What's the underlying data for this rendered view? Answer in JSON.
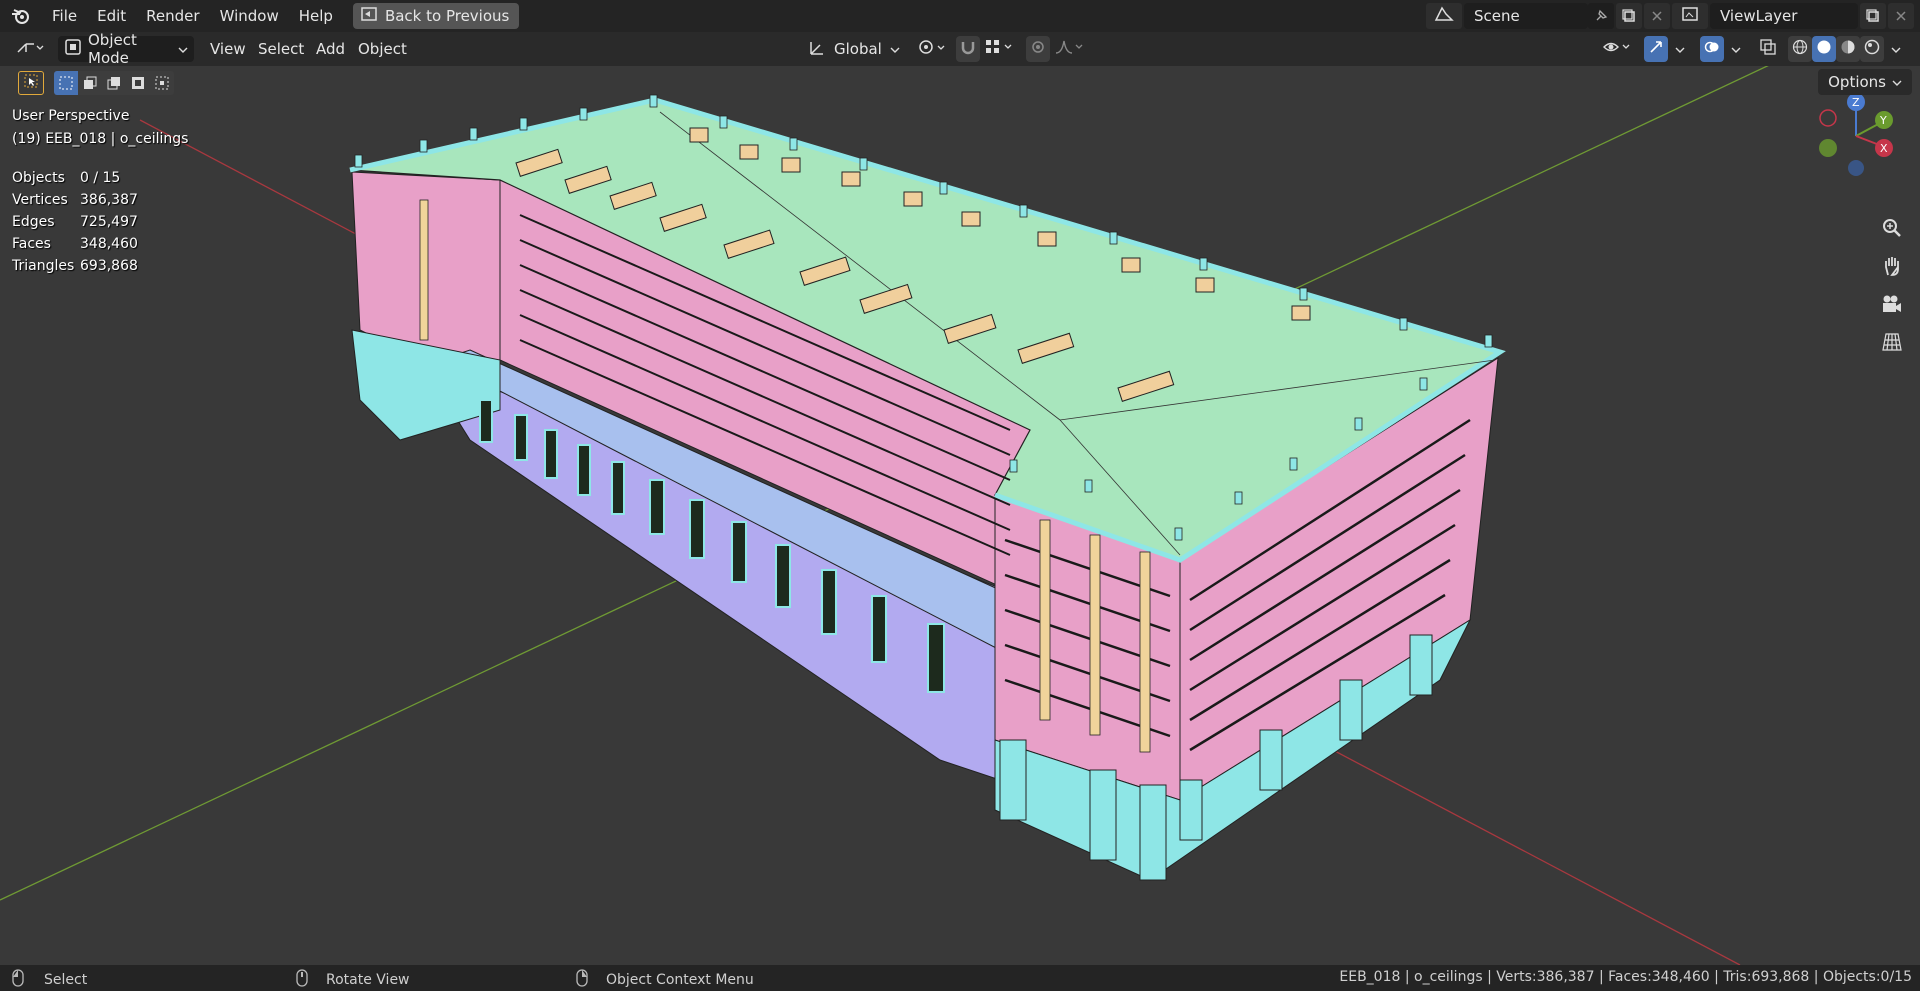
{
  "menu": {
    "items": [
      "File",
      "Edit",
      "Render",
      "Window",
      "Help"
    ],
    "back_button": "Back to Previous"
  },
  "scene": {
    "name": "Scene"
  },
  "view_layer": {
    "name": "ViewLayer"
  },
  "header": {
    "mode": "Object Mode",
    "view": "View",
    "select": "Select",
    "add": "Add",
    "object": "Object",
    "transform_orientation": "Global"
  },
  "viewport": {
    "perspective": "User Perspective",
    "object_info": "(19) EEB_018 | o_ceilings",
    "stats": [
      {
        "label": "Objects",
        "value": "0 / 15"
      },
      {
        "label": "Vertices",
        "value": "386,387"
      },
      {
        "label": "Edges",
        "value": "725,497"
      },
      {
        "label": "Faces",
        "value": "348,460"
      },
      {
        "label": "Triangles",
        "value": "693,868"
      }
    ],
    "options": "Options",
    "gizmo": {
      "z": "Z",
      "y": "Y",
      "x": "X"
    }
  },
  "statusbar": {
    "select": "Select",
    "rotate": "Rotate View",
    "context": "Object Context Menu",
    "info": "EEB_018 | o_ceilings | Verts:386,387 | Faces:348,460 | Tris:693,868 | Objects:0/15"
  },
  "colors": {
    "roof": "#a8e6bd",
    "wall": "#e8a0c8",
    "trim": "#8ee6e6",
    "ground": "#a8b4f0",
    "window_yellow": "#f0d49a",
    "x_axis": "#b0373f",
    "y_axis": "#6b9b2e"
  }
}
